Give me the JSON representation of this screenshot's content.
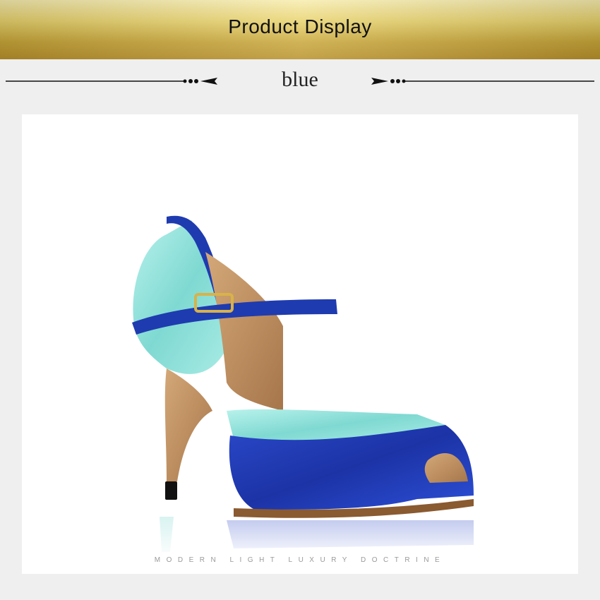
{
  "banner": {
    "title": "Product Display"
  },
  "variant": {
    "color_label": "blue"
  },
  "product": {
    "tagline": "MODERN LIGHT LUXURY DOCTRINE",
    "image": "blue-and-aqua-satin-peep-toe-dance-heel",
    "colors": {
      "royal_blue": "#1f3bb0",
      "aqua": "#8fe3dc",
      "tan_lining": "#b9875a",
      "gold": "#d8b24a"
    }
  }
}
